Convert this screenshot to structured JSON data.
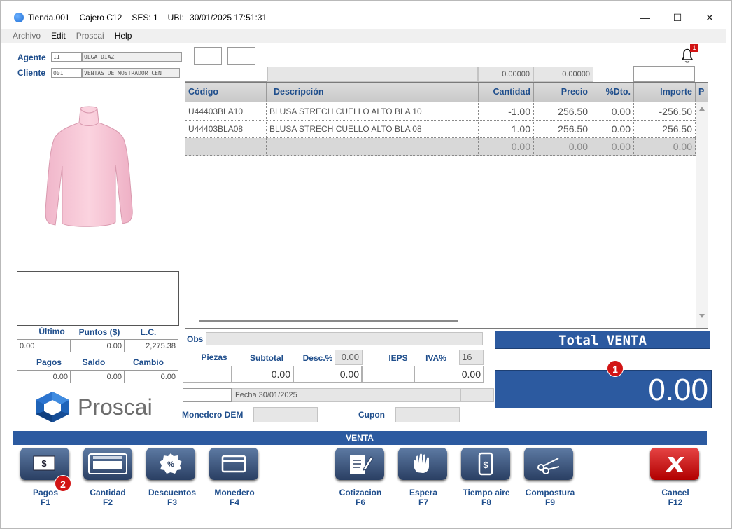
{
  "titlebar": {
    "store": "Tienda.001",
    "cashier": "Cajero C12",
    "session": "SES: 1",
    "ubi": "UBI:",
    "datetime": "30/01/2025 17:51:31",
    "minimize": "—",
    "maximize": "☐",
    "close": "✕"
  },
  "menu": {
    "archivo": "Archivo",
    "edit": "Edit",
    "proscai": "Proscai",
    "help": "Help"
  },
  "agent": {
    "label": "Agente",
    "code": "11",
    "name": "OLGA DIAZ"
  },
  "client": {
    "label": "Cliente",
    "code": "001",
    "name": "VENTAS DE MOSTRADOR CEN"
  },
  "notification_count": "1",
  "header_fields": {
    "val1": "0.00000",
    "val2": "0.00000"
  },
  "grid": {
    "columns": [
      "Código",
      "Descripción",
      "Cantidad",
      "Precio",
      "%Dto.",
      "Importe",
      "P"
    ],
    "rows": [
      {
        "code": "U44403BLA10",
        "desc": "BLUSA STRECH CUELLO ALTO BLA 10",
        "qty": "-1.00",
        "price": "256.50",
        "disc": "0.00",
        "amount": "-256.50"
      },
      {
        "code": "U44403BLA08",
        "desc": "BLUSA STRECH CUELLO ALTO BLA 08",
        "qty": "1.00",
        "price": "256.50",
        "disc": "0.00",
        "amount": "256.50"
      },
      {
        "code": "",
        "desc": "",
        "qty": "0.00",
        "price": "0.00",
        "disc": "0.00",
        "amount": "0.00"
      }
    ]
  },
  "left_stats": {
    "ultimo_label": "Último",
    "puntos_label": "Puntos ($)",
    "lc_label": "L.C.",
    "ultimo": "0.00",
    "puntos": "0.00",
    "lc": "2,275.38",
    "pagos_label": "Pagos",
    "saldo_label": "Saldo",
    "cambio_label": "Cambio",
    "pagos": "0.00",
    "saldo": "0.00",
    "cambio": "0.00"
  },
  "obs_label": "Obs",
  "summary": {
    "piezas_label": "Piezas",
    "subtotal_label": "Subtotal",
    "desc_label": "Desc.%",
    "desc_value": "0.00",
    "ieps_label": "IEPS",
    "iva_label": "IVA%",
    "iva_value": "16",
    "subtotal": "0.00",
    "desc_amount": "0.00",
    "iva_amount": "0.00",
    "fecha": "Fecha 30/01/2025",
    "monedero_label": "Monedero DEM",
    "cupon_label": "Cupon"
  },
  "total": {
    "title": "Total VENTA",
    "value": "0.00",
    "badge": "1"
  },
  "logo_text": "Proscai",
  "venta_bar": "VENTA",
  "buttons": [
    {
      "label": "Pagos",
      "key": "F1"
    },
    {
      "label": "Cantidad",
      "key": "F2"
    },
    {
      "label": "Descuentos",
      "key": "F3"
    },
    {
      "label": "Monedero",
      "key": "F4"
    },
    {
      "label": "Cotizacion",
      "key": "F6"
    },
    {
      "label": "Espera",
      "key": "F7"
    },
    {
      "label": "Tiempo aire",
      "key": "F8"
    },
    {
      "label": "Compostura",
      "key": "F9"
    },
    {
      "label": "Cancel",
      "key": "F12"
    }
  ],
  "pagos_badge": "2",
  "colors": {
    "accent_blue": "#2c5aa0",
    "label_blue": "#1f4e8c",
    "badge_red": "#d21414",
    "cancel_red": "#cc1b1b"
  }
}
